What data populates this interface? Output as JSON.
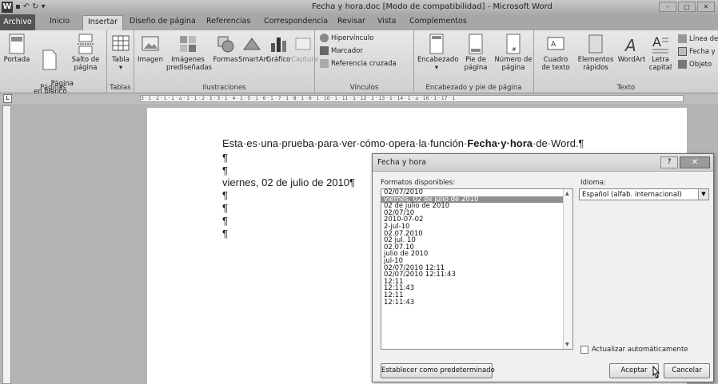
{
  "title_bar": {
    "title": "Fecha y hora.doc [Modo de compatibilidad] - Microsoft Word",
    "logo": "W",
    "min": "–",
    "max": "□",
    "close": "✕"
  },
  "tabs": [
    "Archivo",
    "Inicio",
    "Insertar",
    "Diseño de página",
    "Referencias",
    "Correspondencia",
    "Revisar",
    "Vista",
    "Complementos"
  ],
  "ribbon": {
    "paginas": {
      "label": "Páginas",
      "portada": "Portada",
      "pagina_blanco": "Página\nen blanco",
      "salto": "Salto de\npágina"
    },
    "tablas": {
      "label": "Tablas",
      "tabla": "Tabla"
    },
    "ilustraciones": {
      "label": "Ilustraciones",
      "imagen": "Imagen",
      "imagenes": "Imágenes\nprediseñadas",
      "formas": "Formas",
      "smartart": "SmartArt",
      "grafico": "Gráfico",
      "captura": "Captura"
    },
    "vinculos": {
      "label": "Vínculos",
      "hipervinculo": "Hipervínculo",
      "marcador": "Marcador",
      "referencia": "Referencia cruzada"
    },
    "encabezado": {
      "label": "Encabezado y pie de página",
      "encabezado": "Encabezado",
      "pie": "Pie de\npágina",
      "numero": "Número de\npágina"
    },
    "texto": {
      "label": "Texto",
      "cuadro": "Cuadro\nde texto",
      "elementos": "Elementos\nrápidos",
      "wordart": "WordArt",
      "letra": "Letra\ncapital",
      "linea": "Línea de f",
      "fecha": "Fecha y h",
      "objeto": "Objeto"
    }
  },
  "ruler": "3 · 1 · 2 · 1 · 1 · ⌂ · 1 · 1 · 2 · 1 · 3 · 1 · 4 · 1 · 5 · 1 · 6 · 1 · 7 · 1 · 8 · 1 · 9 · 1 · 10 · 1 · 11 · 1 · 12 · 1 · 13 · 1 · 14 · 1 · ⌂ · 16 · 1 · 17 · 1",
  "document": {
    "line1_pre": "Esta·es·una·prueba·para·ver·cómo·opera·la·función·",
    "line1_bold": "Fecha·y·hora",
    "line1_post": "·de·Word.¶",
    "para": "¶",
    "date_line": "viernes, 02 de julio de 2010¶"
  },
  "dialog": {
    "title": "Fecha y hora",
    "help": "?",
    "close": "✕",
    "formats_label": "Formatos disponibles:",
    "formats": [
      "02/07/2010",
      "viernes, 02 de julio de 2010",
      "02 de julio de 2010",
      "02/07/10",
      "2010-07-02",
      "2-jul-10",
      "02.07.2010",
      "02 jul. 10",
      "02.07.10",
      "julio de 2010",
      "jul-10",
      "02/07/2010 12:11",
      "02/07/2010 12:11:43",
      "12:11",
      "12:11:43",
      "12:11",
      "12:11:43"
    ],
    "selected_index": 1,
    "language_label": "Idioma:",
    "language": "Español (alfab. internacional)",
    "auto_update": "Actualizar automáticamente",
    "default_button": "Establecer como predeterminado",
    "ok_button": "Aceptar",
    "cancel_button": "Cancelar"
  }
}
